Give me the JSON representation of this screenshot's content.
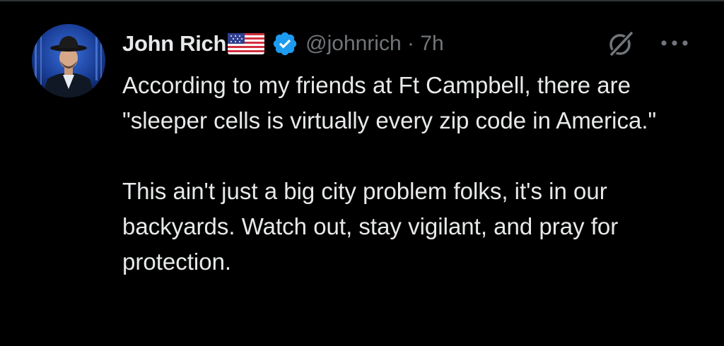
{
  "tweet": {
    "author": {
      "display_name": "John Rich",
      "handle": "@johnrich",
      "separator": "·",
      "time_ago": "7h",
      "badges": [
        "us-flag-emoji",
        "verified-badge"
      ]
    },
    "body": {
      "paragraph_1": "According to my friends at Ft Campbell, there are \"sleeper cells is virtually every zip code in America.\"",
      "paragraph_2": "This ain't just a big city problem folks, it's in our backyards. Watch out, stay vigilant, and pray for protection."
    },
    "actions": {
      "grok_icon": "grok-icon",
      "more_icon": "more-options-icon"
    }
  },
  "colors": {
    "background": "#000000",
    "primary_text": "#e7e9ea",
    "secondary_text": "#71767b",
    "verified_blue": "#1d9bf0"
  }
}
